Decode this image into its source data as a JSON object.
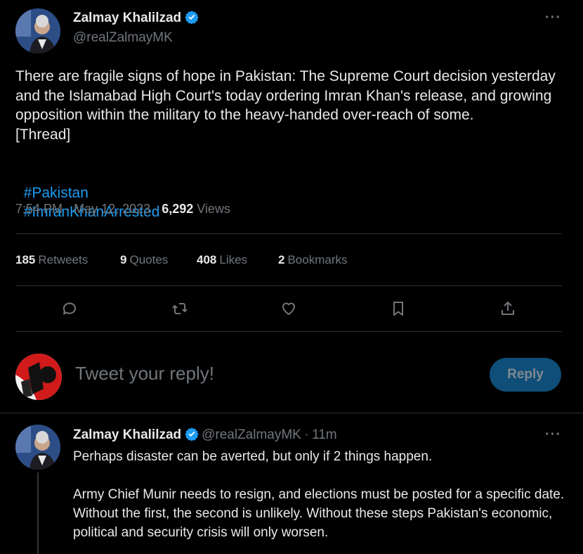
{
  "tweet": {
    "author_name": "Zalmay Khalilzad",
    "author_handle": "@realZalmayMK",
    "text": "There are fragile signs of hope in Pakistan: The Supreme Court decision yesterday and the Islamabad High Court's today ordering Imran Khan's release, and growing opposition within the military to the heavy-handed over-reach of some.\n[Thread]",
    "hashtags": [
      "#Pakistan",
      "#ImranKhanArrested"
    ],
    "time": "7:54 PM",
    "date": "May 12, 2023",
    "views_count": "6,292",
    "views_label": "Views",
    "stats": [
      {
        "num": "185",
        "label": "Retweets"
      },
      {
        "num": "9",
        "label": "Quotes"
      },
      {
        "num": "408",
        "label": "Likes"
      },
      {
        "num": "2",
        "label": "Bookmarks"
      }
    ],
    "more_icon": "more-dots-icon"
  },
  "reply_box": {
    "placeholder": "Tweet your reply!",
    "button_label": "Reply"
  },
  "reply": {
    "author_name": "Zalmay Khalilzad",
    "author_handle": "@realZalmayMK",
    "separator": "·",
    "time": "11m",
    "text": "Perhaps disaster can be averted, but only if 2 things happen.\n\nArmy Chief Munir needs to resign, and elections must be posted for a specific date. Without the first, the second is unlikely. Without these steps Pakistan's economic, political and security crisis will only worsen."
  },
  "colors": {
    "background": "#000000",
    "accent": "#1d9bf0",
    "muted": "#71767b",
    "divider": "#2f3336",
    "reply_button": "#0f4e78"
  }
}
